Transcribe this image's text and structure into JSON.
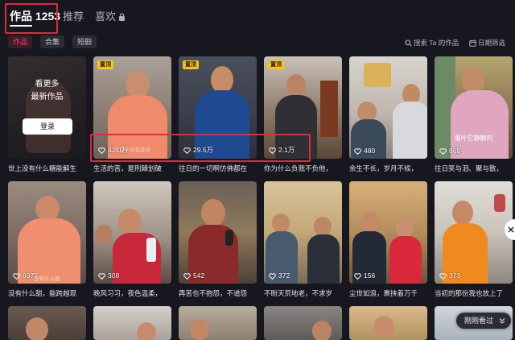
{
  "tabs": {
    "works": "作品 1253",
    "recommend": "推荐",
    "likes": "喜欢"
  },
  "subtabs": [
    "作品",
    "合集",
    "短剧"
  ],
  "toolbar": {
    "search": "搜索 Ta 的作品",
    "filter": "日期筛选"
  },
  "more_card": {
    "line1": "看更多",
    "line2": "最新作品",
    "login": "登录",
    "caption": "世上没有什么糖能解生"
  },
  "row1": [
    {
      "pin": "置顶",
      "likes": "41.0万",
      "overlay": "生活不仅仅是苦",
      "caption": "生活的苦，是刑棘划破"
    },
    {
      "pin": "置顶",
      "likes": "29.5万",
      "overlay": "",
      "caption": "往日的一切啊仿佛都在"
    },
    {
      "pin": "置顶",
      "likes": "2.1万",
      "overlay": "",
      "caption": "你为什么负我不负他，"
    },
    {
      "pin": "",
      "likes": "480",
      "overlay": "",
      "caption": "余生不长，岁月不候，"
    },
    {
      "pin": "",
      "likes": "865",
      "overlay": "落叶它静静的",
      "caption": "往日笑与泪、聚与散，"
    }
  ],
  "row2": [
    {
      "likes": "6977",
      "overlay": "没有什么甜",
      "caption": "没有什么甜，能跨越现"
    },
    {
      "likes": "308",
      "overlay": "",
      "caption": "晚风习习，夜色温柔，"
    },
    {
      "likes": "542",
      "overlay": "",
      "caption": "再苦也不抱怨，不道怨"
    },
    {
      "likes": "372",
      "overlay": "",
      "caption": "不盼天荒地老，不求岁"
    },
    {
      "likes": "156",
      "overlay": "",
      "caption": "尘世如浪，裹挟着万千"
    },
    {
      "likes": "373",
      "overlay": "",
      "caption": "当初的那份我也放上了"
    }
  ],
  "float_button": "刚刚看过",
  "colors": {
    "background": "#16171f",
    "accent": "#ff3d5a",
    "highlight_box": "#e32a3a",
    "pin": "#f5c518"
  }
}
